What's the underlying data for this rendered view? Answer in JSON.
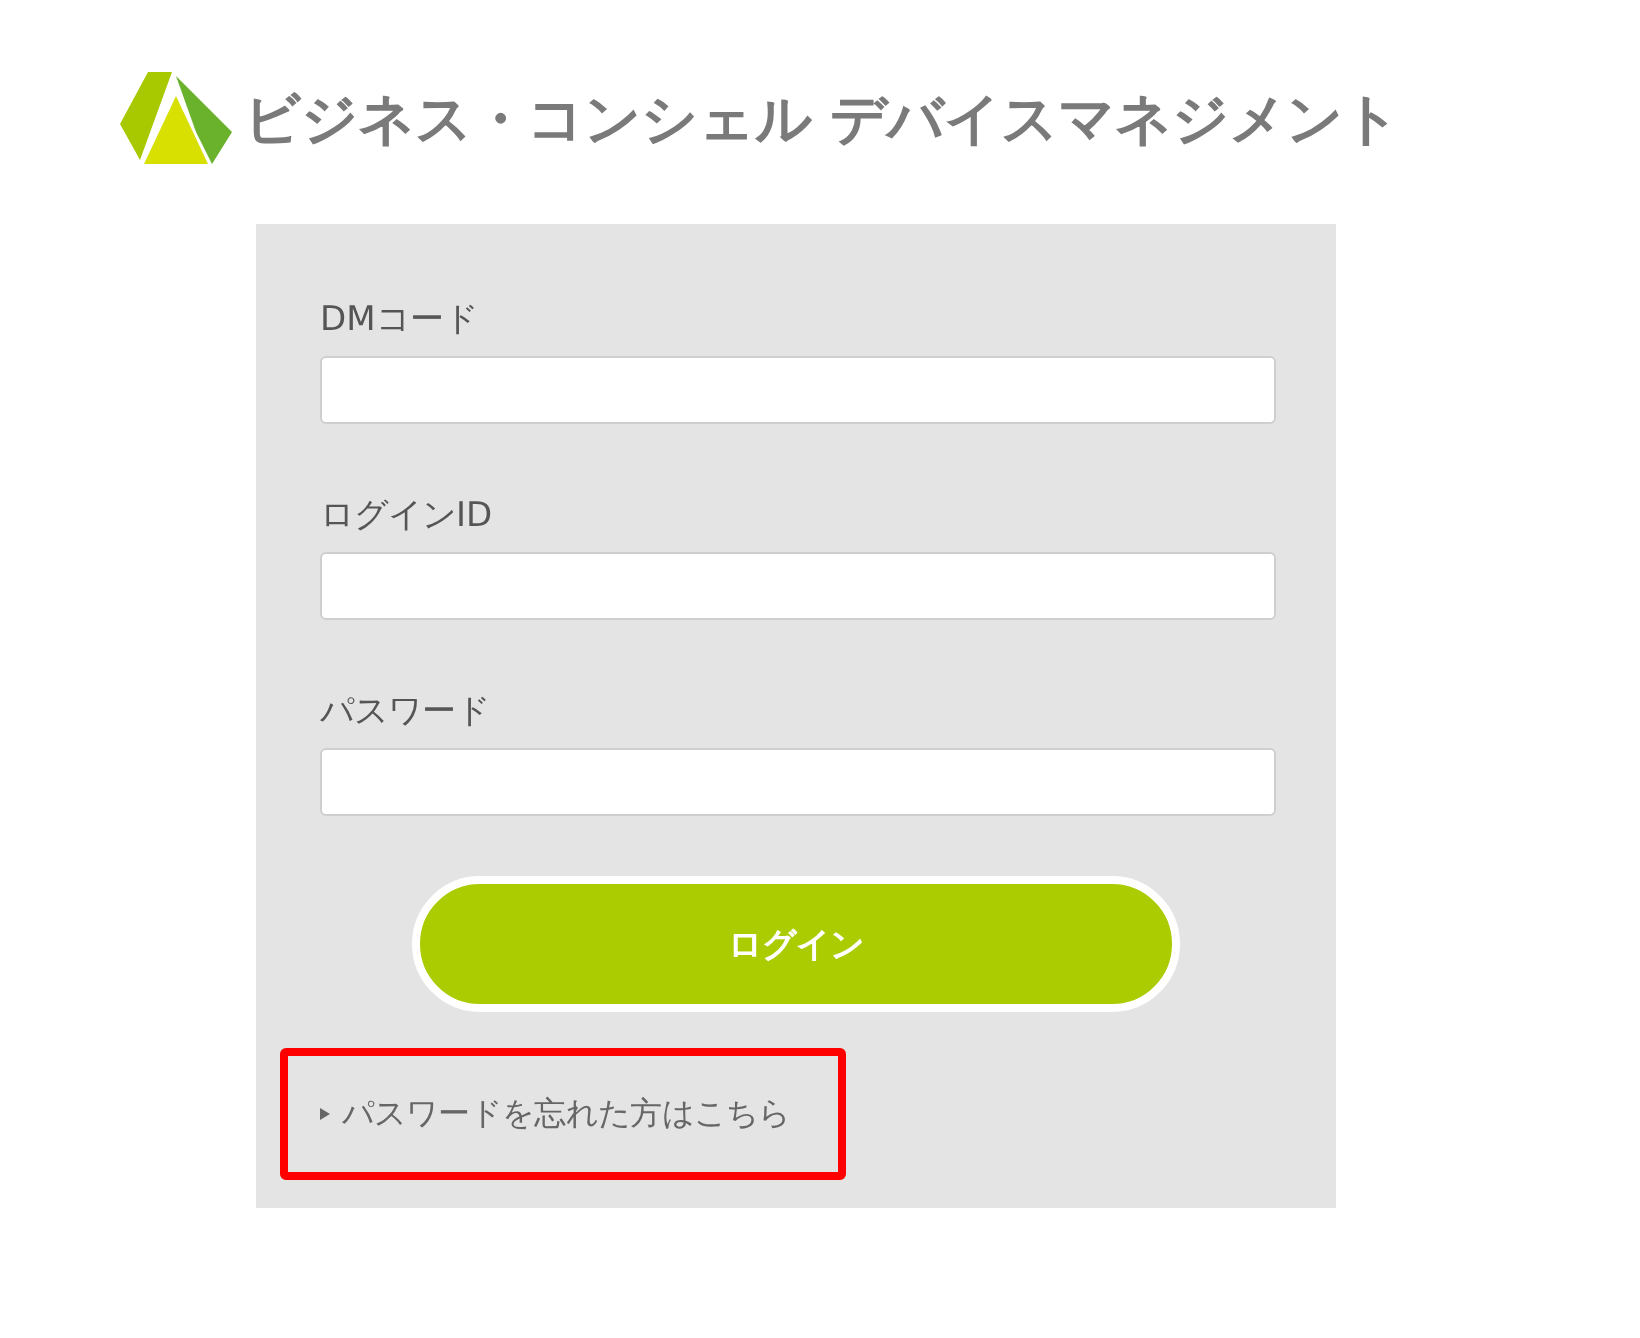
{
  "header": {
    "title": "ビジネス・コンシェル デバイスマネジメント"
  },
  "form": {
    "fields": [
      {
        "label": "DMコード"
      },
      {
        "label": "ログインID"
      },
      {
        "label": "パスワード"
      }
    ],
    "login_button": "ログイン",
    "forgot_link": {
      "text": "パスワードを忘れた方はこちら",
      "highlighted": true
    }
  }
}
